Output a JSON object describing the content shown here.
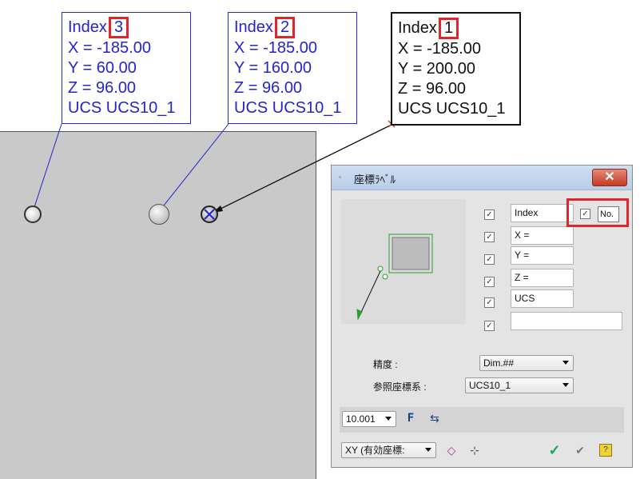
{
  "labels": [
    {
      "index_label": "Index",
      "index_value": "3",
      "x": "X = -185.00",
      "y": "Y = 60.00",
      "z": "Z = 96.00",
      "ucs": "UCS UCS10_1"
    },
    {
      "index_label": "Index",
      "index_value": "2",
      "x": "X = -185.00",
      "y": "Y = 160.00",
      "z": "Z = 96.00",
      "ucs": "UCS UCS10_1"
    },
    {
      "index_label": "Index",
      "index_value": "1",
      "x": "X = -185.00",
      "y": "Y = 200.00",
      "z": "Z = 96.00",
      "ucs": "UCS UCS10_1"
    }
  ],
  "dialog": {
    "title": "座標ﾗﾍﾞﾙ",
    "close_glyph": "✕",
    "fields": [
      "Index",
      "X =",
      "Y =",
      "Z =",
      "UCS",
      ""
    ],
    "no_label": "No.",
    "precision_label": "精度 :",
    "precision_value": "Dim.##",
    "ref_ucs_label": "参照座標系 :",
    "ref_ucs_value": "UCS10_1",
    "scale_value": "10.001",
    "plane_value": "XY (有効座標:",
    "checkmark": "✓"
  },
  "colors": {
    "label_blue": "#2424c8",
    "highlight_red": "#e0262b",
    "ok_green": "#1aa84a"
  }
}
